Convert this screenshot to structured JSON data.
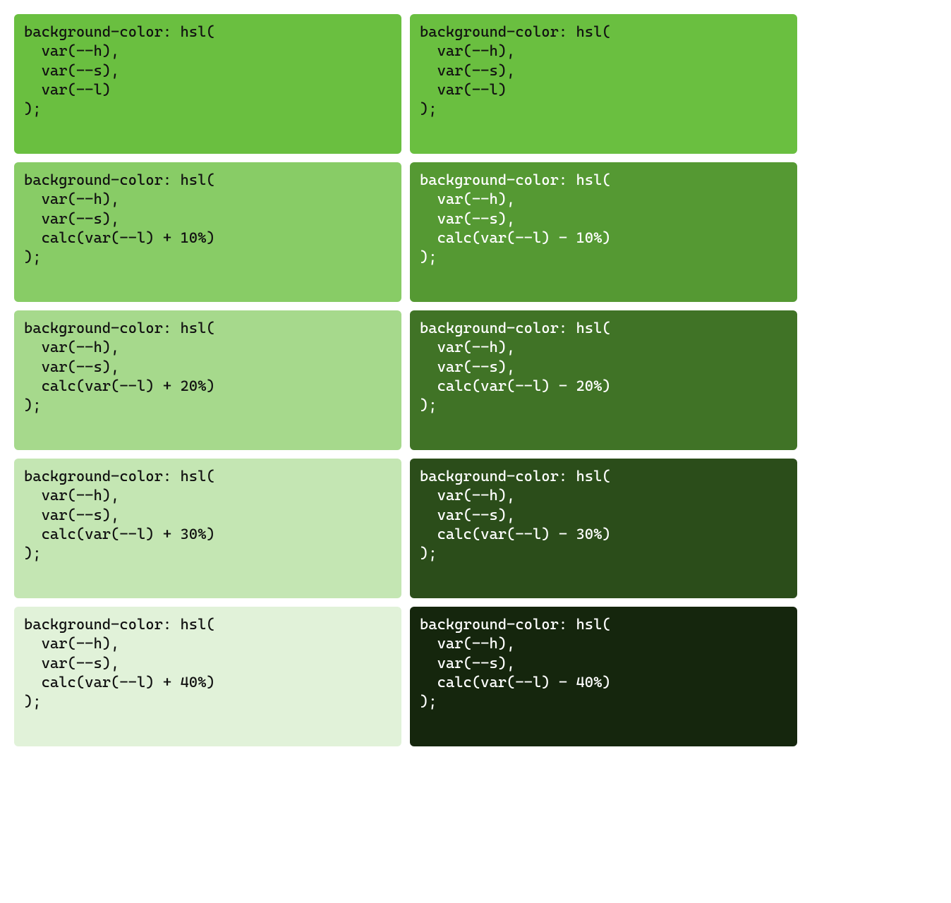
{
  "hsl": {
    "h": 100,
    "s": 50,
    "l": 50
  },
  "swatches": [
    {
      "id": "left-0",
      "column": "left",
      "deltaL": 0,
      "bg": "hsl(100,50%,50%)",
      "textClass": "dark-text",
      "code": "background-color: hsl(\n  var(--h),\n  var(--s),\n  var(--l)\n);"
    },
    {
      "id": "right-0",
      "column": "right",
      "deltaL": 0,
      "bg": "hsl(100,50%,50%)",
      "textClass": "dark-text",
      "code": "background-color: hsl(\n  var(--h),\n  var(--s),\n  var(--l)\n);"
    },
    {
      "id": "left-10",
      "column": "left",
      "deltaL": 10,
      "bg": "hsl(100,50%,60%)",
      "textClass": "dark-text",
      "code": "background-color: hsl(\n  var(--h),\n  var(--s),\n  calc(var(--l) + 10%)\n);"
    },
    {
      "id": "right-10",
      "column": "right",
      "deltaL": -10,
      "bg": "hsl(100,50%,40%)",
      "textClass": "light-text",
      "code": "background-color: hsl(\n  var(--h),\n  var(--s),\n  calc(var(--l) - 10%)\n);"
    },
    {
      "id": "left-20",
      "column": "left",
      "deltaL": 20,
      "bg": "hsl(100,50%,70%)",
      "textClass": "dark-text",
      "code": "background-color: hsl(\n  var(--h),\n  var(--s),\n  calc(var(--l) + 20%)\n);"
    },
    {
      "id": "right-20",
      "column": "right",
      "deltaL": -20,
      "bg": "hsl(100,50%,30%)",
      "textClass": "light-text",
      "code": "background-color: hsl(\n  var(--h),\n  var(--s),\n  calc(var(--l) - 20%)\n);"
    },
    {
      "id": "left-30",
      "column": "left",
      "deltaL": 30,
      "bg": "hsl(100,50%,80%)",
      "textClass": "dark-text",
      "code": "background-color: hsl(\n  var(--h),\n  var(--s),\n  calc(var(--l) + 30%)\n);"
    },
    {
      "id": "right-30",
      "column": "right",
      "deltaL": -30,
      "bg": "hsl(100,50%,20%)",
      "textClass": "light-text",
      "code": "background-color: hsl(\n  var(--h),\n  var(--s),\n  calc(var(--l) - 30%)\n);"
    },
    {
      "id": "left-40",
      "column": "left",
      "deltaL": 40,
      "bg": "hsl(100,50%,90%)",
      "textClass": "dark-text",
      "code": "background-color: hsl(\n  var(--h),\n  var(--s),\n  calc(var(--l) + 40%)\n);"
    },
    {
      "id": "right-40",
      "column": "right",
      "deltaL": -40,
      "bg": "hsl(100,50%,10%)",
      "textClass": "light-text",
      "code": "background-color: hsl(\n  var(--h),\n  var(--s),\n  calc(var(--l) - 40%)\n);"
    }
  ]
}
